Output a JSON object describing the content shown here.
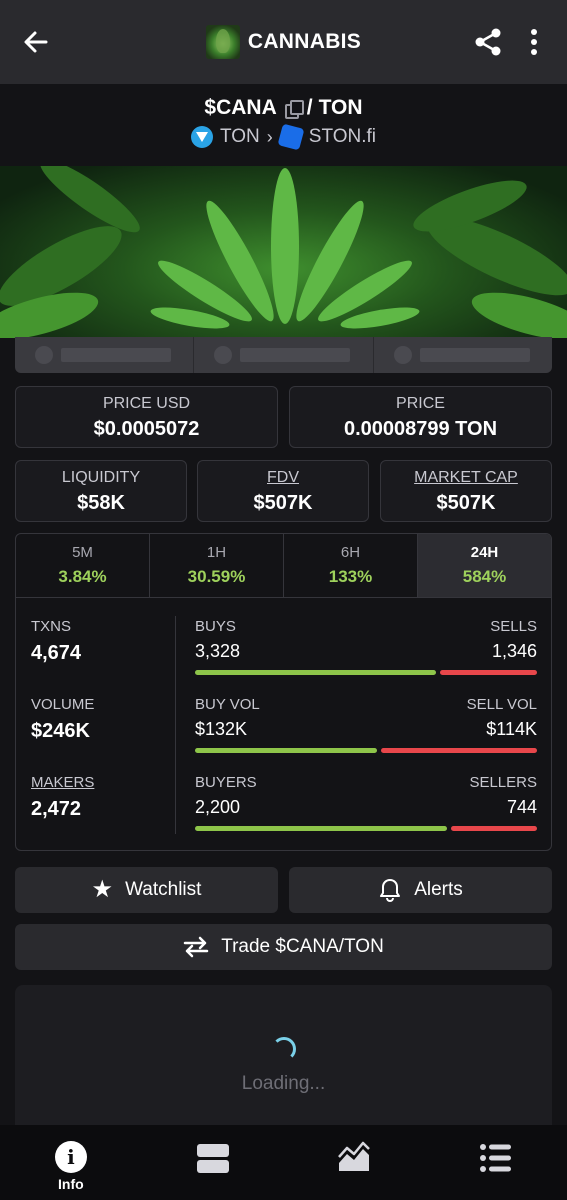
{
  "appbar": {
    "title": "CANNABIS"
  },
  "pair": {
    "base": "$CANA",
    "separator": "/",
    "quote": "TON",
    "chain": "TON",
    "dex": "STON.fi"
  },
  "prices": {
    "price_usd_label": "PRICE USD",
    "price_usd": "$0.0005072",
    "price_label": "PRICE",
    "price": "0.00008799 TON"
  },
  "metrics": {
    "liquidity_label": "LIQUIDITY",
    "liquidity": "$58K",
    "fdv_label": "FDV",
    "fdv": "$507K",
    "mcap_label": "MARKET CAP",
    "mcap": "$507K"
  },
  "timeframes": [
    {
      "label": "5M",
      "change": "3.84%"
    },
    {
      "label": "1H",
      "change": "30.59%"
    },
    {
      "label": "6H",
      "change": "133%"
    },
    {
      "label": "24H",
      "change": "584%"
    }
  ],
  "stats": {
    "txns_label": "TXNS",
    "txns": "4,674",
    "volume_label": "VOLUME",
    "volume": "$246K",
    "makers_label": "MAKERS",
    "makers": "2,472",
    "buys_label": "BUYS",
    "buys": "3,328",
    "sells_label": "SELLS",
    "sells": "1,346",
    "buys_fraction": 0.712,
    "buyvol_label": "BUY VOL",
    "buyvol": "$132K",
    "sellvol_label": "SELL VOL",
    "sellvol": "$114K",
    "buyvol_fraction": 0.537,
    "buyers_label": "BUYERS",
    "buyers": "2,200",
    "sellers_label": "SELLERS",
    "sellers": "744",
    "buyers_fraction": 0.747
  },
  "actions": {
    "watchlist": "Watchlist",
    "alerts": "Alerts",
    "trade": "Trade $CANA/TON"
  },
  "chart": {
    "loading": "Loading..."
  },
  "nav": {
    "info": "Info"
  },
  "colors": {
    "positive": "#9ed15c",
    "buy_bar": "#8ec54a",
    "sell_bar": "#e8474b",
    "spinner": "#7ad0e8"
  }
}
